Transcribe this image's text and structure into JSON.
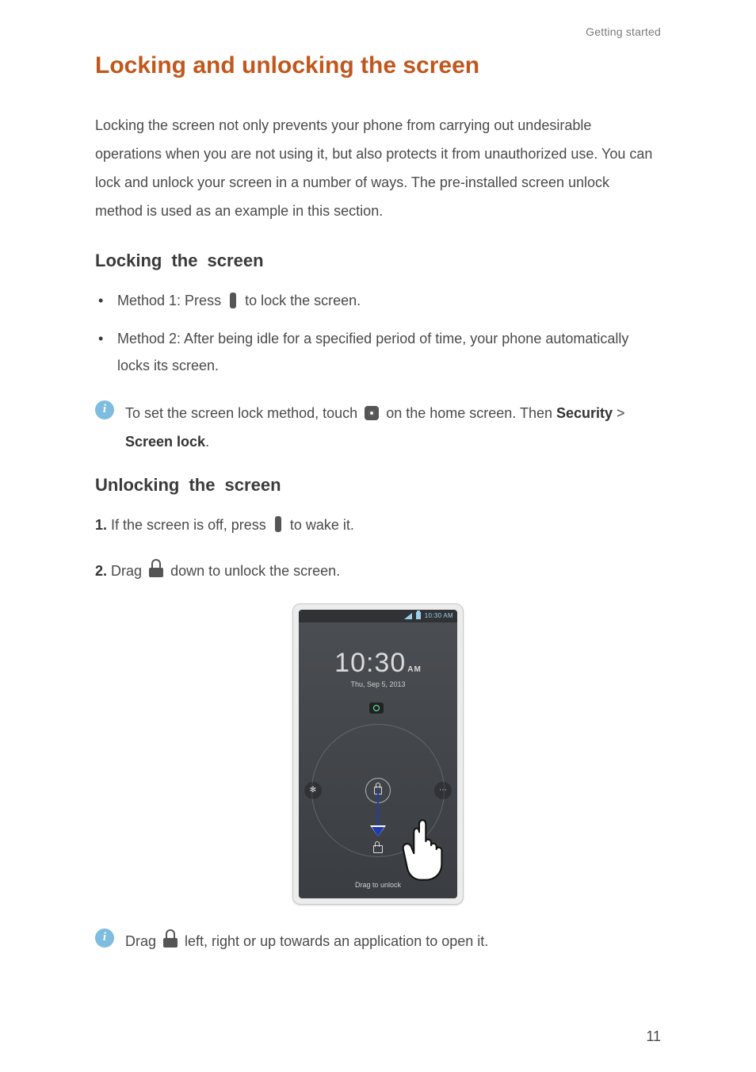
{
  "header": {
    "running": "Getting started"
  },
  "title": "Locking and unlocking the screen",
  "intro": "Locking the screen not only prevents your phone from carrying out undesirable operations when you are not using it, but also protects it from unauthorized use. You can lock and unlock your screen in a number of ways. The pre-installed screen unlock method is used as an example in this section.",
  "sections": {
    "locking": {
      "heading": "Locking the screen",
      "m1a": "Method 1: Press ",
      "m1b": " to lock the screen.",
      "m2": "Method 2: After being idle for a specified period of time, your phone automatically locks its screen.",
      "tip_a": "To set the screen lock method, touch ",
      "tip_b": " on the home screen. Then ",
      "tip_bold1": "Security",
      "tip_sep": " > ",
      "tip_bold2": "Screen lock",
      "tip_end": "."
    },
    "unlocking": {
      "heading": "Unlocking the screen",
      "s1n": "1.",
      "s1a": " If the screen is off, press ",
      "s1b": " to wake it.",
      "s2n": "2.",
      "s2a": " Drag ",
      "s2b": " down to unlock the screen.",
      "tip_a": "Drag ",
      "tip_b": " left, right or up towards an application to open it."
    }
  },
  "phone": {
    "status_time": "10:30 AM",
    "clock_time": "10:30",
    "clock_ampm": "AM",
    "clock_date": "Thu, Sep 5, 2013",
    "drag_label": "Drag to unlock"
  },
  "page_number": "11"
}
